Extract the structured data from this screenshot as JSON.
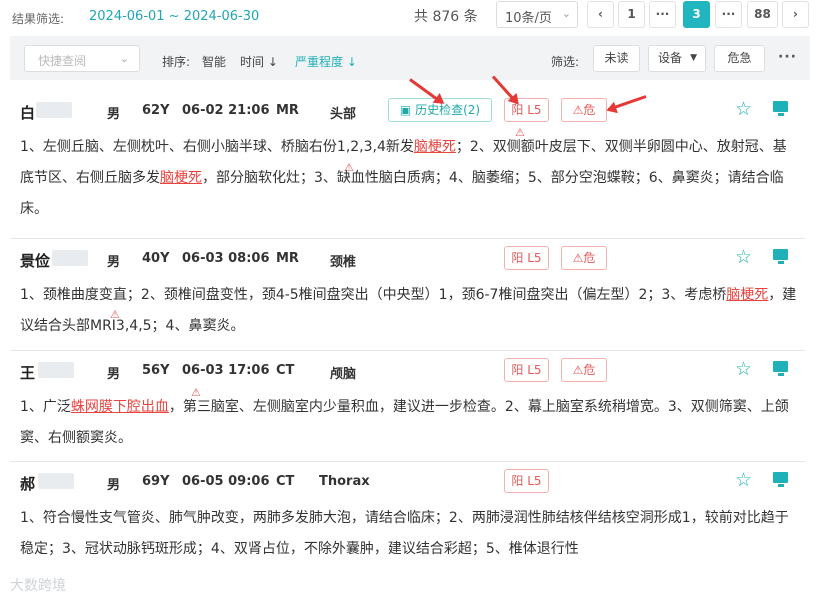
{
  "header": {
    "filter_label": "结果筛选:",
    "date_range": "2024-06-01 ~ 2024-06-30",
    "total": "共 876 条",
    "page_size": "10条/页",
    "pages": [
      "1",
      "3",
      "88"
    ],
    "current_page": "3",
    "ellipsis": "···"
  },
  "toolbar": {
    "quick_search_placeholder": "快捷查阅",
    "sort_label": "排序:",
    "sort_smart": "智能",
    "sort_time": "时间 ↓",
    "sort_severity": "严重程度 ↓",
    "filter_label": "筛选:",
    "unread": "未读",
    "device": "设备",
    "critical": "危急",
    "more": "···"
  },
  "records": [
    {
      "name": "白",
      "sex": "男",
      "age": "62Y",
      "time": "06-02 21:06",
      "modality": "MR",
      "part": "头部",
      "history": "历史检查(2)",
      "positive": "阳 L5",
      "critical": "危",
      "pre": "1、左侧丘脑、左侧枕叶、右侧小脑半球、桥脑右份1,2,3,4新发",
      "kw1": "脑梗死",
      "mid": "；2、双侧额叶皮层下、双侧半卵圆中心、放射冠、基底节区、右侧丘脑多发",
      "kw2": "脑梗死",
      "post": "，部分脑软化灶；3、缺血性脑白质病；4、脑萎缩；5、部分空泡蝶鞍；6、鼻窦炎；请结合临床。"
    },
    {
      "name": "景俭",
      "sex": "男",
      "age": "40Y",
      "time": "06-03 08:06",
      "modality": "MR",
      "part": "颈椎",
      "positive": "阳 L5",
      "critical": "危",
      "pre": "1、颈椎曲度变直；2、颈椎间盘变性，颈4-5椎间盘突出（中央型）1，颈6-7椎间盘突出（偏左型）2；3、考虑桥",
      "kw1": "脑梗死",
      "post": "，建议结合头部MRI3,4,5；4、鼻窦炎。"
    },
    {
      "name": "王",
      "sex": "男",
      "age": "56Y",
      "time": "06-03 17:06",
      "modality": "CT",
      "part": "颅脑",
      "positive": "阳 L5",
      "critical": "危",
      "pre": "1、广泛",
      "kw1": "蛛网膜下腔出血",
      "post": "，第三脑室、左侧脑室内少量积血，建议进一步检查。2、幕上脑室系统稍增宽。3、双侧筛窦、上颌窦、右侧额窦炎。"
    },
    {
      "name": "郝",
      "sex": "男",
      "age": "69Y",
      "time": "06-05 09:06",
      "modality": "CT",
      "part": "Thorax",
      "positive": "阳 L5",
      "text": "1、符合慢性支气管炎、肺气肿改变，两肺多发肺大泡，请结合临床；2、两肺浸润性肺结核伴结核空洞形成1，较前对比趋于稳定；3、冠状动脉钙斑形成；4、双肾占位，不除外囊肿，建议结合彩超；5、椎体退行性"
    }
  ],
  "watermark": "大数跨境"
}
